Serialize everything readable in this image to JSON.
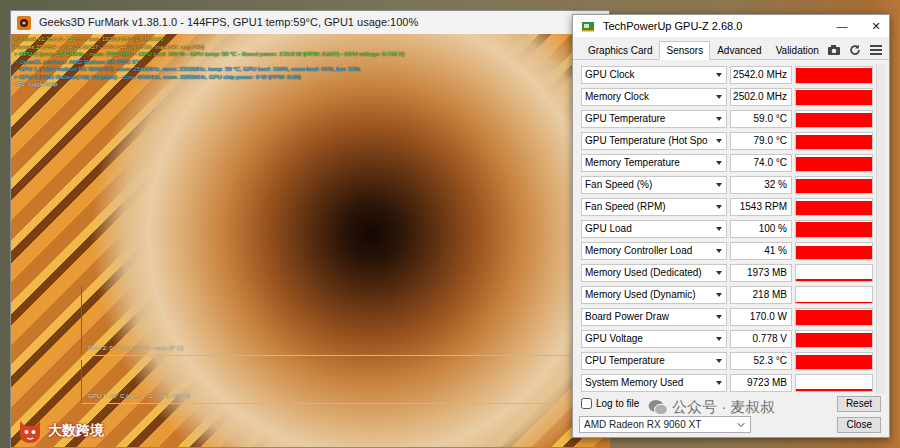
{
  "furmark": {
    "title": "Geeks3D FurMark v1.38.1.0 - 144FPS, GPU1 temp:59°C, GPU1 usage:100%",
    "osd": [
      {
        "text": "FurMark v1.38.1.0 - Burn-in test, 1920x1080 (0X MSAA)",
        "color": "#ffe14a"
      },
      {
        "text": "Frames:296264 - time:00:29:57 - FPS:144 (min:139, max:147, avg:145)",
        "color": "#ffe14a"
      },
      {
        "text": "> GPU-Z (core: 2542 MHz - mem: 2502 MHz - GPU load: 100 % - GPU temp: 59 °C - Board power: 170.0 W (PPW: 0.847) - GPU voltage: 0.778 V)",
        "color": "#7cff6a"
      },
      {
        "text": "> OpenGL renderer: AMD Radeon RX 9060 XT",
        "color": "#5fd8ff"
      },
      {
        "text": "> GPU 1 (AMD Radeon RX 9060 XT) - core: 2542MHz, mem: 2502MHz, temp: 59 °C, GPU load: 100%, mem load: 41%, fan: 32%",
        "color": "#5fd8ff"
      },
      {
        "text": "> GPU 2 (AMD Radeon(TM) Graphics) - core: 600MHz, mem: 2800MHz, GPU chip power: 0 W (PPW: 0.00)",
        "color": "#5fd8ff"
      },
      {
        "text": "- F1: toggle help",
        "color": "#ffffff"
      }
    ],
    "graphs": [
      "GPU 2: 0° C (min: 0° C - max: 0° C)",
      "GPU 1: 59° C (min: 0° C - max: 60° C)"
    ]
  },
  "gpuz": {
    "title": "TechPowerUp GPU-Z 2.68.0",
    "controls": [
      "—",
      "✕"
    ],
    "tabs": [
      {
        "label": "Graphics Card",
        "selected": false
      },
      {
        "label": "Sensors",
        "selected": true
      },
      {
        "label": "Advanced",
        "selected": false
      },
      {
        "label": "Validation",
        "selected": false
      }
    ],
    "sensors": [
      {
        "label": "GPU Clock",
        "value": "2542.0 MHz",
        "level": 0.92
      },
      {
        "label": "Memory Clock",
        "value": "2502.0 MHz",
        "level": 0.92
      },
      {
        "label": "GPU Temperature",
        "value": "59.0 °C",
        "level": 0.9
      },
      {
        "label": "GPU Temperature (Hot Spo",
        "value": "79.0 °C",
        "level": 0.9
      },
      {
        "label": "Memory Temperature",
        "value": "74.0 °C",
        "level": 0.9
      },
      {
        "label": "Fan Speed (%)",
        "value": "32 %",
        "level": 0.88
      },
      {
        "label": "Fan Speed (RPM)",
        "value": "1543 RPM",
        "level": 0.85
      },
      {
        "label": "GPU Load",
        "value": "100 %",
        "level": 0.95
      },
      {
        "label": "Memory Controller Load",
        "value": "41 %",
        "level": 0.8
      },
      {
        "label": "Memory Used (Dedicated)",
        "value": "1973 MB",
        "level": 0.1
      },
      {
        "label": "Memory Used (Dynamic)",
        "value": "218 MB",
        "level": 0.06
      },
      {
        "label": "Board Power Draw",
        "value": "170.0 W",
        "level": 0.92
      },
      {
        "label": "GPU Voltage",
        "value": "0.778 V",
        "level": 0.88
      },
      {
        "label": "CPU Temperature",
        "value": "52.3 °C",
        "level": 0.85
      },
      {
        "label": "System Memory Used",
        "value": "9723 MB",
        "level": 0.12
      }
    ],
    "log_to_file": {
      "label": "Log to file",
      "checked": false
    },
    "reset": "Reset",
    "device": "AMD Radeon RX 9060 XT",
    "close": "Close"
  },
  "watermark": "公众号 · 麦叔叔",
  "logo": "大数跨境"
}
